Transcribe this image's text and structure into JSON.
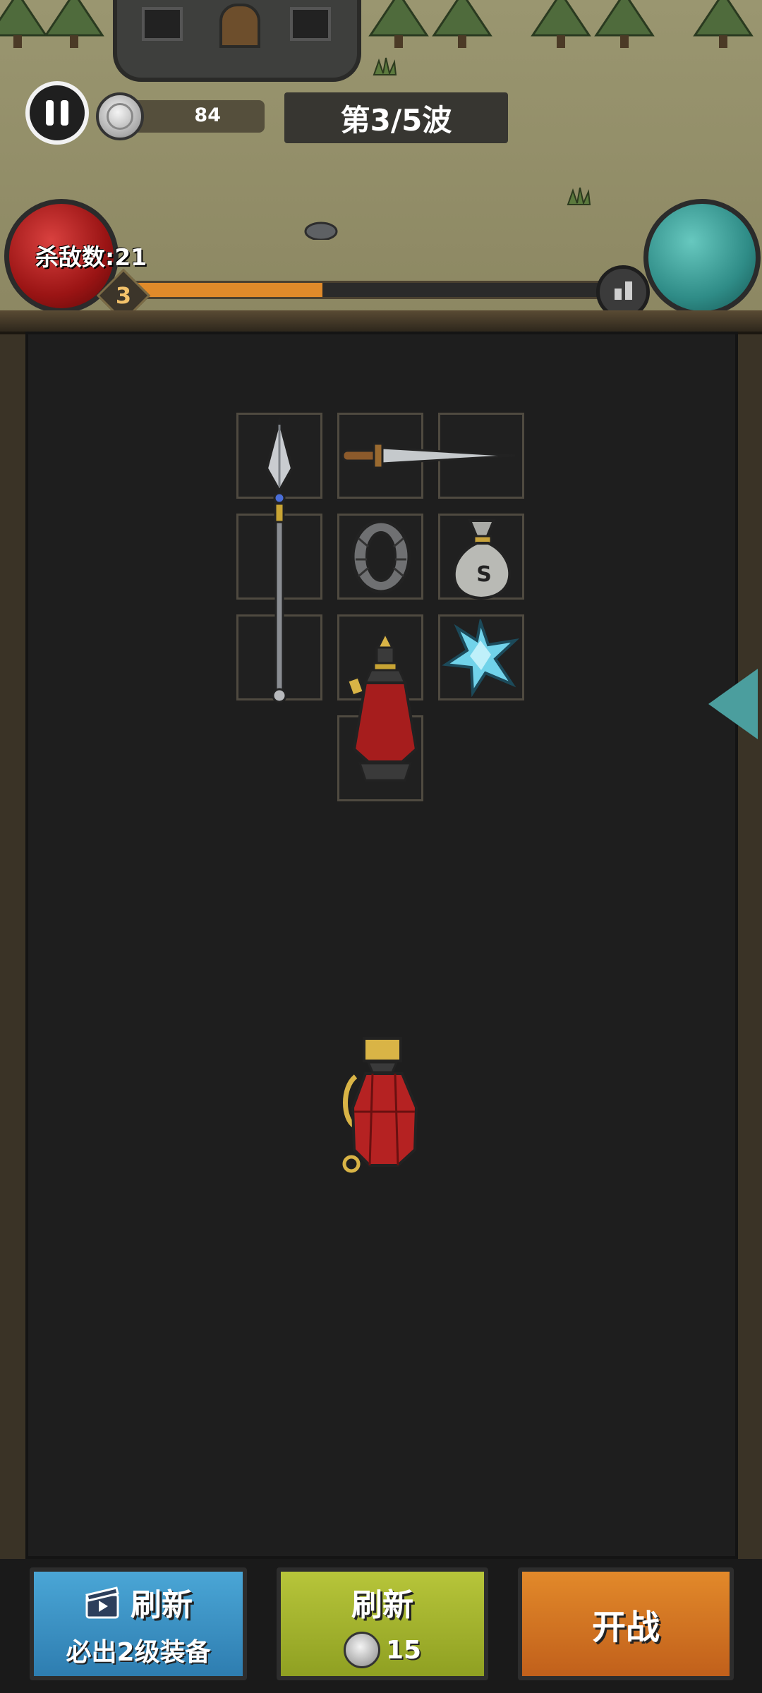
{
  "hud": {
    "coins": "84",
    "wave": "第3/5波",
    "kills": "杀敌数:21",
    "level": "3",
    "xp_progress": 0.4
  },
  "board": {
    "items": [
      {
        "name": "spear",
        "slots": "col1 rows1-3"
      },
      {
        "name": "dagger",
        "slots": "col2-3 row1"
      },
      {
        "name": "ring",
        "slots": "col2 row2"
      },
      {
        "name": "money-bag",
        "slots": "col3 row2"
      },
      {
        "name": "ice-crystal",
        "slots": "col3 row3"
      },
      {
        "name": "red-potion",
        "slots": "col2 rows3-4"
      }
    ],
    "loose_item": "red-lantern-potion"
  },
  "buttons": {
    "refresh_ad_label": "刷新",
    "refresh_ad_sub": "必出2级装备",
    "refresh_coin_label": "刷新",
    "refresh_coin_cost": "15",
    "start_label": "开战"
  },
  "colors": {
    "xp_fill": "#e08a2a",
    "blue_button": "#3a93c6",
    "yellow_button": "#a6b52e",
    "orange_button": "#d4761f"
  }
}
